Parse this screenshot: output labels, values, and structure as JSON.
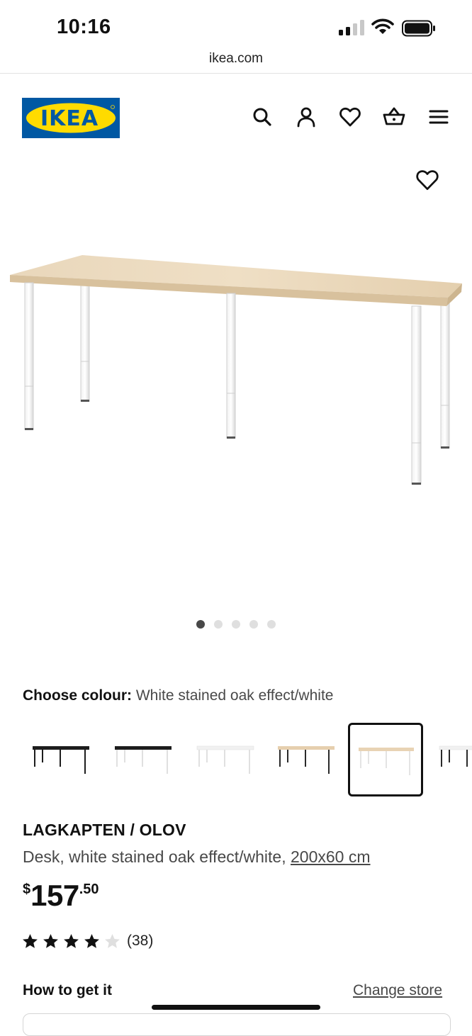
{
  "status_bar": {
    "time": "10:16",
    "icons": [
      "cellular-signal-icon",
      "wifi-icon",
      "battery-icon"
    ]
  },
  "browser": {
    "url": "ikea.com"
  },
  "header": {
    "logo_text": "IKEA",
    "brand_colors": {
      "blue": "#0058a3",
      "yellow": "#ffdb00"
    },
    "icons": [
      "search-icon",
      "account-icon",
      "favorites-icon",
      "cart-icon",
      "menu-icon"
    ]
  },
  "gallery": {
    "image_count": 5,
    "active_index": 0
  },
  "colour": {
    "label": "Choose colour:",
    "value": "White stained oak effect/white",
    "swatches": [
      {
        "top": "#1d1d1d",
        "legs": "#1d1d1d"
      },
      {
        "top": "#1d1d1d",
        "legs": "#e9e9e9"
      },
      {
        "top": "#f4f4f4",
        "legs": "#e9e9e9"
      },
      {
        "top": "#e6cfae",
        "legs": "#2a2a2a"
      },
      {
        "top": "#e8d3b4",
        "legs": "#ececec",
        "selected": true
      },
      {
        "top": "#f4f4f4",
        "legs": "#2a2a2a"
      }
    ]
  },
  "product": {
    "name": "LAGKAPTEN / OLOV",
    "description": "Desk, white stained oak effect/white,",
    "size": "200x60 cm",
    "price": {
      "currency": "$",
      "integer": "157",
      "decimal": ".50"
    },
    "rating": {
      "value": 4,
      "max": 5,
      "count": "(38)"
    }
  },
  "delivery": {
    "heading": "How to get it",
    "change_store_label": "Change store"
  }
}
